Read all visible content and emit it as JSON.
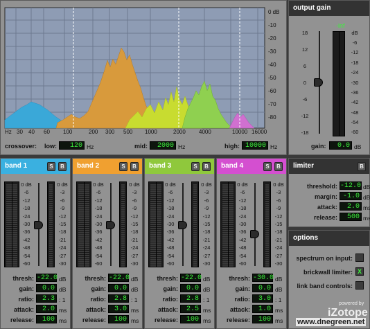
{
  "spectrum": {
    "db_scale": [
      "0 dB",
      "-10",
      "-20",
      "-30",
      "-40",
      "-50",
      "-60",
      "-70",
      "-80"
    ],
    "freq_ticks": [
      "Hz",
      "30",
      "40",
      "60",
      "100",
      "200",
      "300",
      "500",
      "1000",
      "2000",
      "4000",
      "10000",
      "16000"
    ]
  },
  "crossover": {
    "label": "crossover:",
    "low_label": "low:",
    "low_value": "120",
    "low_unit": "Hz",
    "mid_label": "mid:",
    "mid_value": "2000",
    "mid_unit": "Hz",
    "high_label": "high:",
    "high_value": "10000",
    "high_unit": "Hz"
  },
  "output_gain": {
    "title": "output gain",
    "peak_value": "-inf",
    "left_scale": [
      "18",
      "12",
      "6",
      "0",
      "-6",
      "-12",
      "-18"
    ],
    "right_scale": [
      "dB",
      "-6",
      "-12",
      "-18",
      "-24",
      "-30",
      "-36",
      "-42",
      "-48",
      "-54",
      "-60"
    ],
    "gain_label": "gain:",
    "gain_value": "0.0",
    "gain_unit": "dB"
  },
  "limiter": {
    "title": "limiter",
    "bypass": "B",
    "threshold_label": "threshold:",
    "threshold_value": "-12.0",
    "threshold_unit": "dB",
    "margin_label": "margin:",
    "margin_value": "-1.0",
    "margin_unit": "dB",
    "attack_label": "attack:",
    "attack_value": "2.0",
    "attack_unit": "ms",
    "release_label": "release:",
    "release_value": "500",
    "release_unit": "ms"
  },
  "options": {
    "title": "options",
    "spectrum_label": "spectrum on input:",
    "brickwall_label": "brickwall limiter:",
    "brickwall_check": "X",
    "link_label": "link band controls:"
  },
  "band_scales": {
    "left": [
      "0 dB",
      "-6",
      "-12",
      "-18",
      "-24",
      "-30",
      "-36",
      "-42",
      "-48",
      "-54",
      "-60"
    ],
    "right": [
      "0 dB",
      "-3",
      "-6",
      "-9",
      "-12",
      "-15",
      "-18",
      "-21",
      "-24",
      "-27",
      "-30"
    ]
  },
  "band_labels": {
    "solo": "S",
    "bypass": "B",
    "thresh": "thresh:",
    "gain": "gain:",
    "ratio": "ratio:",
    "attack": "attack:",
    "release": "release:",
    "db": "dB",
    "ratio_unit": ": 1",
    "ms": "ms"
  },
  "bands": [
    {
      "title": "band 1",
      "color": "#3ab0e0",
      "thresh": "-22.0",
      "gain": "0.0",
      "ratio": "2.3",
      "attack": "2.0",
      "release": "100"
    },
    {
      "title": "band 2",
      "color": "#f0a030",
      "thresh": "-22.0",
      "gain": "0.0",
      "ratio": "2.8",
      "attack": "3.0",
      "release": "100"
    },
    {
      "title": "band 3",
      "color": "#8fc83c",
      "thresh": "-22.0",
      "gain": "0.0",
      "ratio": "2.8",
      "attack": "2.5",
      "release": "100"
    },
    {
      "title": "band 4",
      "color": "#d44fd0",
      "thresh": "-30.0",
      "gain": "0.0",
      "ratio": "3.0",
      "attack": "1.0",
      "release": "100"
    }
  ],
  "watermark": {
    "powered": "powered by",
    "brand": "iZotope",
    "site": "www.dnegreen.net"
  }
}
